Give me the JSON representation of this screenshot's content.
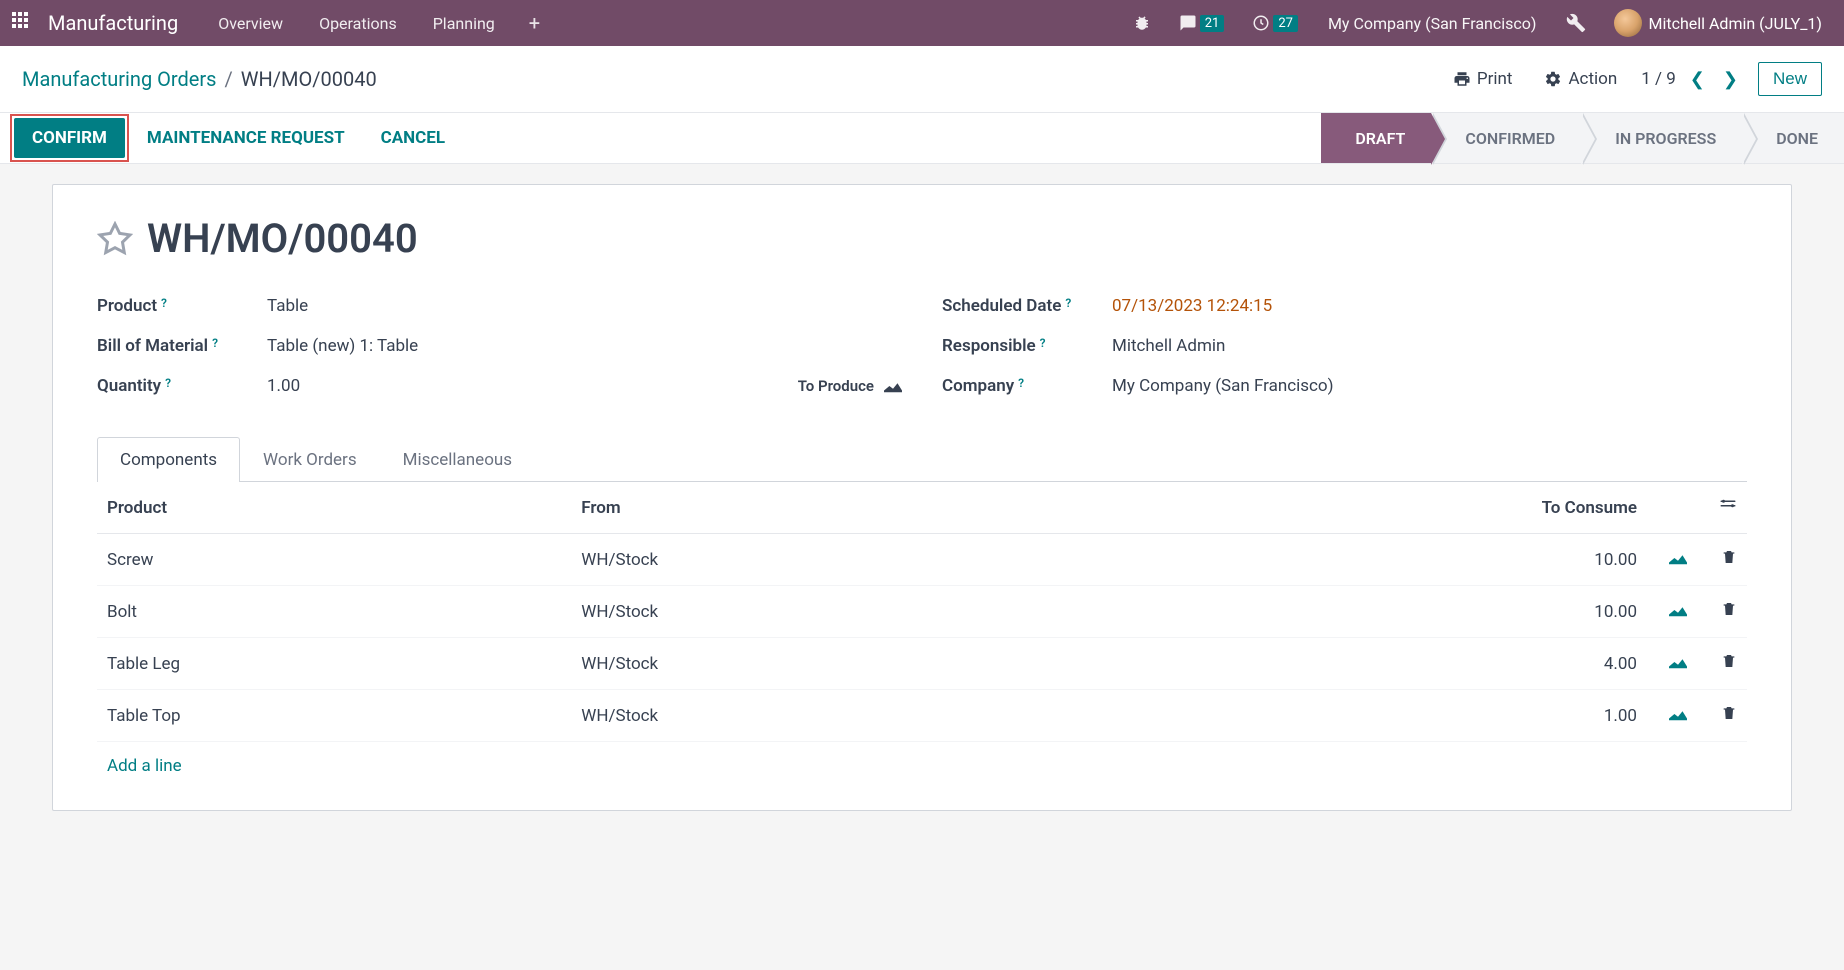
{
  "topbar": {
    "brand": "Manufacturing",
    "nav": [
      "Overview",
      "Operations",
      "Planning"
    ],
    "messages_badge": "21",
    "activities_badge": "27",
    "company": "My Company (San Francisco)",
    "user": "Mitchell Admin (JULY_1)"
  },
  "breadcrumb": {
    "parent": "Manufacturing Orders",
    "current": "WH/MO/00040"
  },
  "controls": {
    "print": "Print",
    "action": "Action",
    "pager": "1 / 9",
    "new": "New"
  },
  "status_buttons": {
    "confirm": "CONFIRM",
    "maintenance": "MAINTENANCE REQUEST",
    "cancel": "CANCEL"
  },
  "status_flow": [
    "DRAFT",
    "CONFIRMED",
    "IN PROGRESS",
    "DONE"
  ],
  "record": {
    "title": "WH/MO/00040",
    "labels": {
      "product": "Product",
      "bom": "Bill of Material",
      "quantity": "Quantity",
      "to_produce": "To Produce",
      "scheduled_date": "Scheduled Date",
      "responsible": "Responsible",
      "company": "Company"
    },
    "values": {
      "product": "Table",
      "bom": "Table (new) 1: Table",
      "quantity": "1.00",
      "scheduled_date": "07/13/2023 12:24:15",
      "responsible": "Mitchell Admin",
      "company": "My Company (San Francisco)"
    }
  },
  "tabs": [
    "Components",
    "Work Orders",
    "Miscellaneous"
  ],
  "components_table": {
    "headers": {
      "product": "Product",
      "from": "From",
      "to_consume": "To Consume"
    },
    "rows": [
      {
        "product": "Screw",
        "from": "WH/Stock",
        "to_consume": "10.00"
      },
      {
        "product": "Bolt",
        "from": "WH/Stock",
        "to_consume": "10.00"
      },
      {
        "product": "Table Leg",
        "from": "WH/Stock",
        "to_consume": "4.00"
      },
      {
        "product": "Table Top",
        "from": "WH/Stock",
        "to_consume": "1.00"
      }
    ],
    "add_line": "Add a line"
  }
}
